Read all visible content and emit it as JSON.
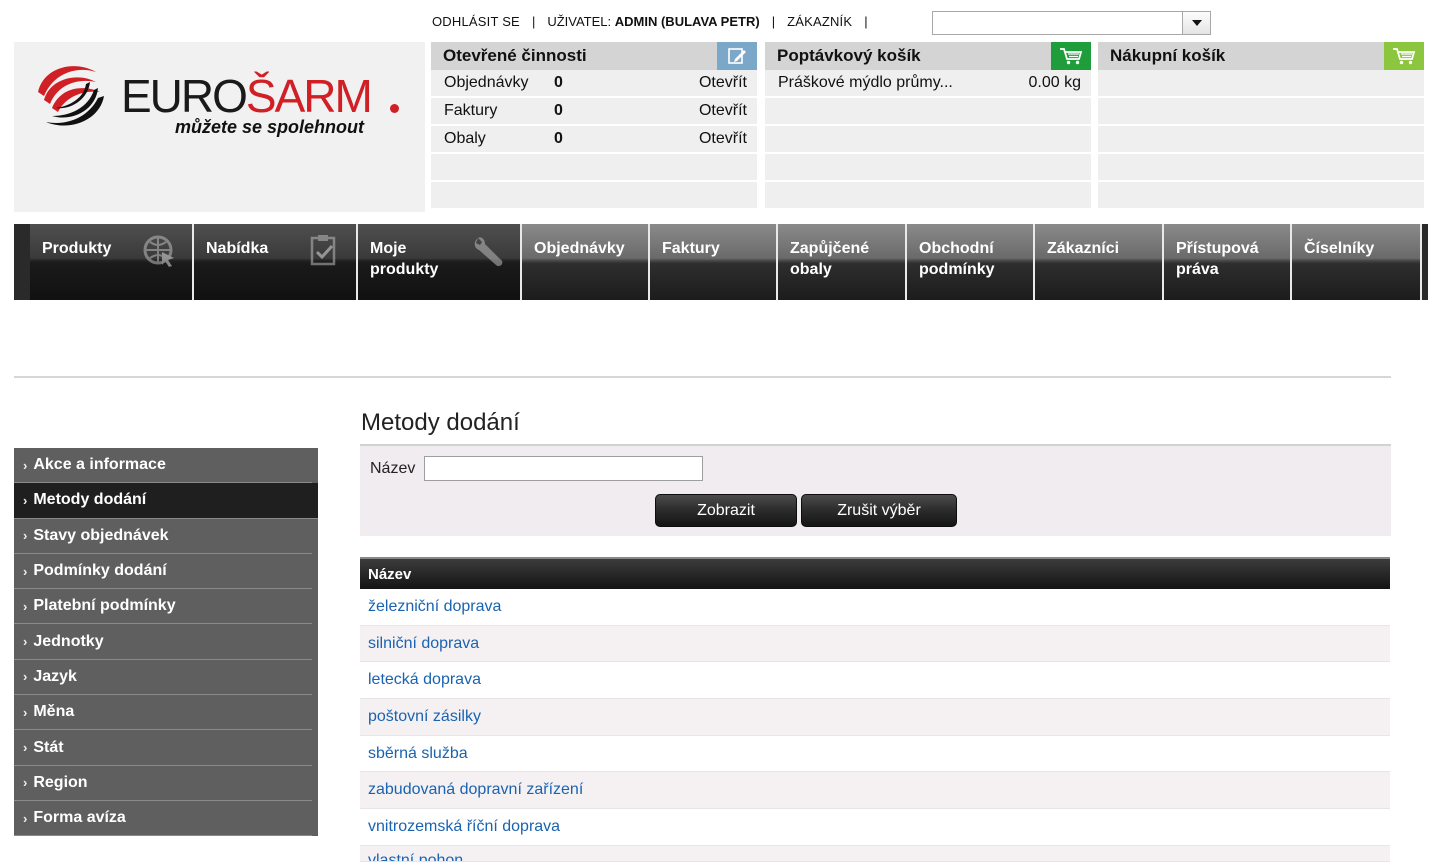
{
  "topbar": {
    "logout": "ODHLÁSIT SE",
    "sep": "|",
    "user_label": "UŽIVATEL:",
    "user_name": "ADMIN (BULAVA PETR)",
    "customer_label": "ZÁKAZNÍK",
    "customer_value": ""
  },
  "logo": {
    "brand_black": "EURO",
    "brand_red": "ŠARM",
    "tagline": "můžete se spolehnout"
  },
  "panels": {
    "open_activities": {
      "title": "Otevřené činnosti",
      "rows": [
        {
          "label": "Objednávky",
          "count": "0",
          "action": "Otevřít"
        },
        {
          "label": "Faktury",
          "count": "0",
          "action": "Otevřít"
        },
        {
          "label": "Obaly",
          "count": "0",
          "action": "Otevřít"
        }
      ]
    },
    "inquiry_basket": {
      "title": "Poptávkový košík",
      "rows": [
        {
          "label": "Práškové mýdlo průmy...",
          "qty": "0.00 kg"
        }
      ]
    },
    "shopping_cart": {
      "title": "Nákupní košík"
    }
  },
  "nav": [
    {
      "label": "Produkty",
      "icon": "globe-cursor-icon"
    },
    {
      "label": "Nabídka",
      "icon": "clipboard-check-icon"
    },
    {
      "label": "Moje produkty",
      "icon": "wrench-icon"
    },
    {
      "label": "Objednávky"
    },
    {
      "label": "Faktury"
    },
    {
      "label": "Zapůjčené obaly"
    },
    {
      "label": "Obchodní podmínky"
    },
    {
      "label": "Zákazníci"
    },
    {
      "label": "Přístupová práva"
    },
    {
      "label": "Číselníky"
    }
  ],
  "sidebar": {
    "items": [
      {
        "label": "Akce a informace"
      },
      {
        "label": "Metody dodání"
      },
      {
        "label": "Stavy objednávek"
      },
      {
        "label": "Podmínky dodání"
      },
      {
        "label": "Platební podmínky"
      },
      {
        "label": "Jednotky"
      },
      {
        "label": "Jazyk"
      },
      {
        "label": "Měna"
      },
      {
        "label": "Stát"
      },
      {
        "label": "Region"
      },
      {
        "label": "Forma avíza"
      }
    ],
    "active_index": 1,
    "chevron": "›"
  },
  "main": {
    "title": "Metody dodání",
    "filter": {
      "name_label": "Název",
      "name_value": "",
      "show_button": "Zobrazit",
      "clear_button": "Zrušit výběr"
    },
    "grid": {
      "header": "Název",
      "rows": [
        "železniční doprava",
        "silniční doprava",
        "letecká doprava",
        "poštovní zásilky",
        "sběrná služba",
        "zabudovaná dopravní zařízení",
        "vnitrozemská říční doprava",
        "vlastní pohon"
      ]
    }
  },
  "colors": {
    "brand_red": "#d01f25",
    "cart_green": "#1e9d3a",
    "cart_lime": "#8cc63f",
    "edit_blue": "#7ba7c9",
    "link_blue": "#1a63b0"
  }
}
